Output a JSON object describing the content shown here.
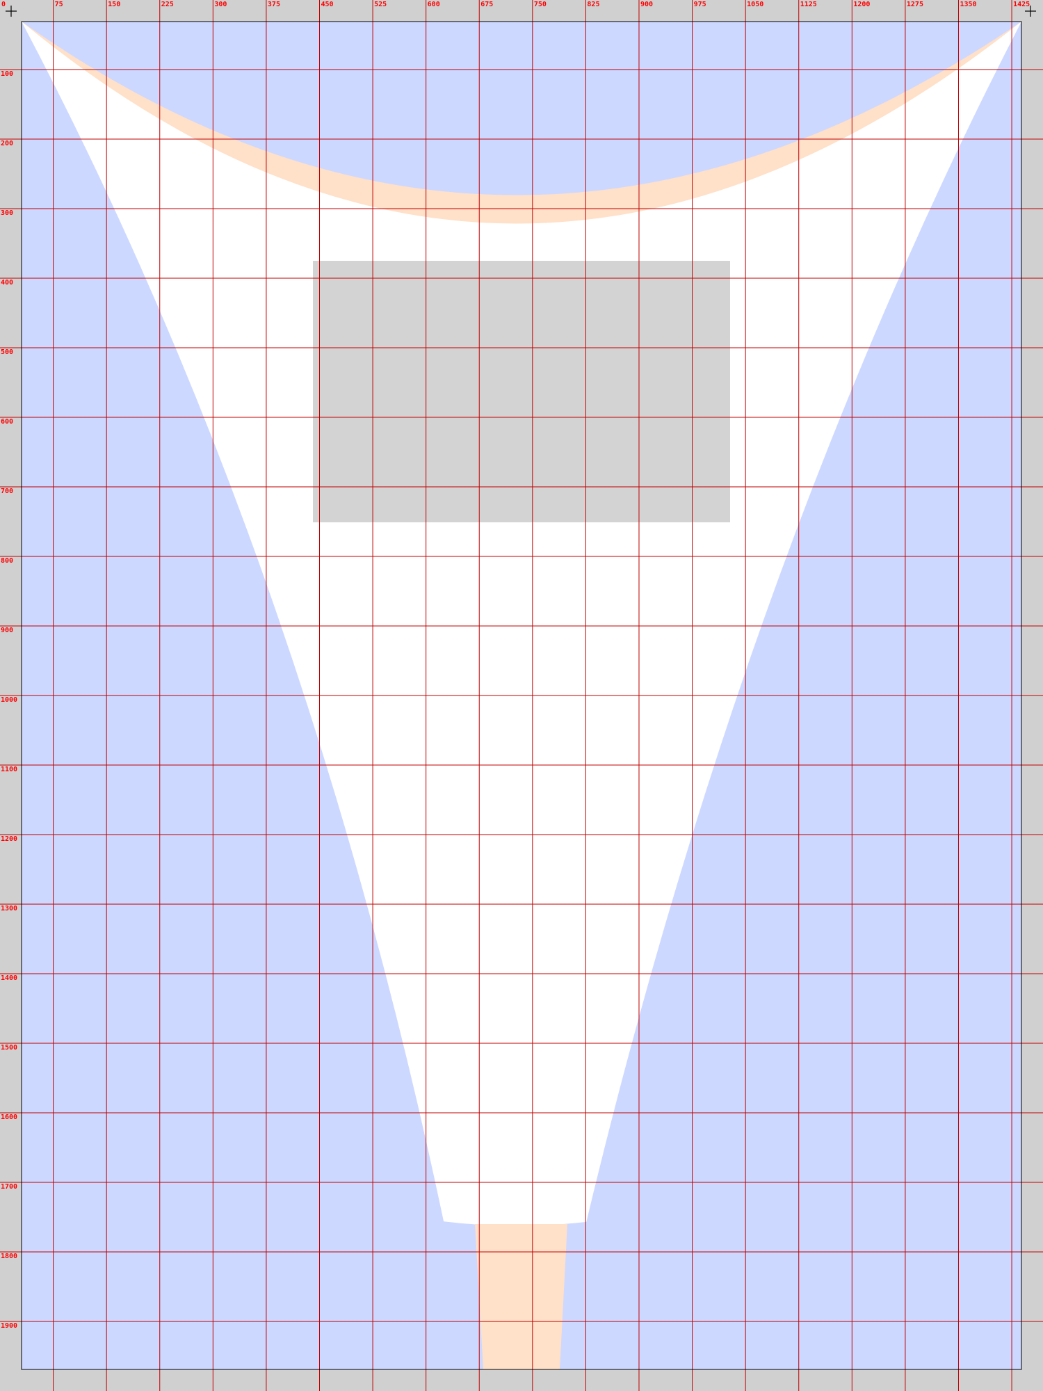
{
  "canvas": {
    "background": "#d0d0d0",
    "paper_fill": "#ffffff",
    "paper_border": "#000000",
    "grid_color": "#c00000",
    "label_color": "#ff0000",
    "blue_fill": "#ccd8ff",
    "peach_fill": "#ffe0c8",
    "gray_block_fill": "#d3d3d3",
    "registration_marks": [
      "top-left-crosshair",
      "top-right-crosshair"
    ]
  },
  "x_axis": {
    "ticks": [
      0,
      75,
      150,
      225,
      300,
      375,
      450,
      525,
      600,
      675,
      750,
      825,
      900,
      975,
      1050,
      1125,
      1200,
      1275,
      1350,
      1425
    ],
    "labels": [
      "0",
      "75",
      "150",
      "225",
      "300",
      "375",
      "450",
      "525",
      "600",
      "675",
      "750",
      "825",
      "900",
      "975",
      "1050",
      "1125",
      "1200",
      "1275",
      "1350",
      "1425"
    ]
  },
  "y_axis": {
    "ticks": [
      100,
      200,
      300,
      400,
      500,
      600,
      700,
      800,
      900,
      1000,
      1100,
      1200,
      1300,
      1400,
      1500,
      1600,
      1700,
      1800,
      1900
    ],
    "labels": [
      "100",
      "200",
      "300",
      "400",
      "500",
      "600",
      "700",
      "800",
      "900",
      "1000",
      "1100",
      "1200",
      "1300",
      "1400",
      "1500",
      "1600",
      "1700",
      "1800",
      "1900"
    ]
  }
}
